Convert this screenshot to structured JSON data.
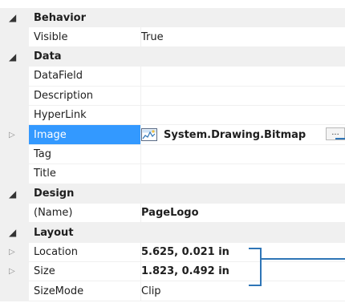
{
  "property_grid": {
    "rows": [
      {
        "kind": "category",
        "name": "Behavior",
        "expanded": true
      },
      {
        "kind": "property",
        "name": "Visible",
        "value": "True",
        "bold_value": false
      },
      {
        "kind": "category",
        "name": "Data",
        "expanded": true
      },
      {
        "kind": "property",
        "name": "DataField",
        "value": "",
        "bold_value": false
      },
      {
        "kind": "property",
        "name": "Description",
        "value": "",
        "bold_value": false
      },
      {
        "kind": "property",
        "name": "HyperLink",
        "value": "",
        "bold_value": false
      },
      {
        "kind": "property",
        "name": "Image",
        "value": "System.Drawing.Bitmap",
        "bold_value": true,
        "selected": true,
        "expandable": true,
        "has_ellipsis": true,
        "icon": "bitmap-icon"
      },
      {
        "kind": "property",
        "name": "Tag",
        "value": "",
        "bold_value": false
      },
      {
        "kind": "property",
        "name": "Title",
        "value": "",
        "bold_value": false
      },
      {
        "kind": "category",
        "name": "Design",
        "expanded": true
      },
      {
        "kind": "property",
        "name": "(Name)",
        "value": "PageLogo",
        "bold_value": true
      },
      {
        "kind": "category",
        "name": "Layout",
        "expanded": true
      },
      {
        "kind": "property",
        "name": "Location",
        "value": "5.625, 0.021 in",
        "bold_value": true,
        "expandable": true
      },
      {
        "kind": "property",
        "name": "Size",
        "value": "1.823, 0.492 in",
        "bold_value": true,
        "expandable": true
      },
      {
        "kind": "property",
        "name": "SizeMode",
        "value": "Clip",
        "bold_value": false
      }
    ],
    "ellipsis_label": "...",
    "expanded_glyph": "◢",
    "collapsed_glyph": "▷"
  },
  "colors": {
    "selection": "#3399ff",
    "category_bg": "#f0f0f0",
    "callout_line": "#2e75b6"
  }
}
